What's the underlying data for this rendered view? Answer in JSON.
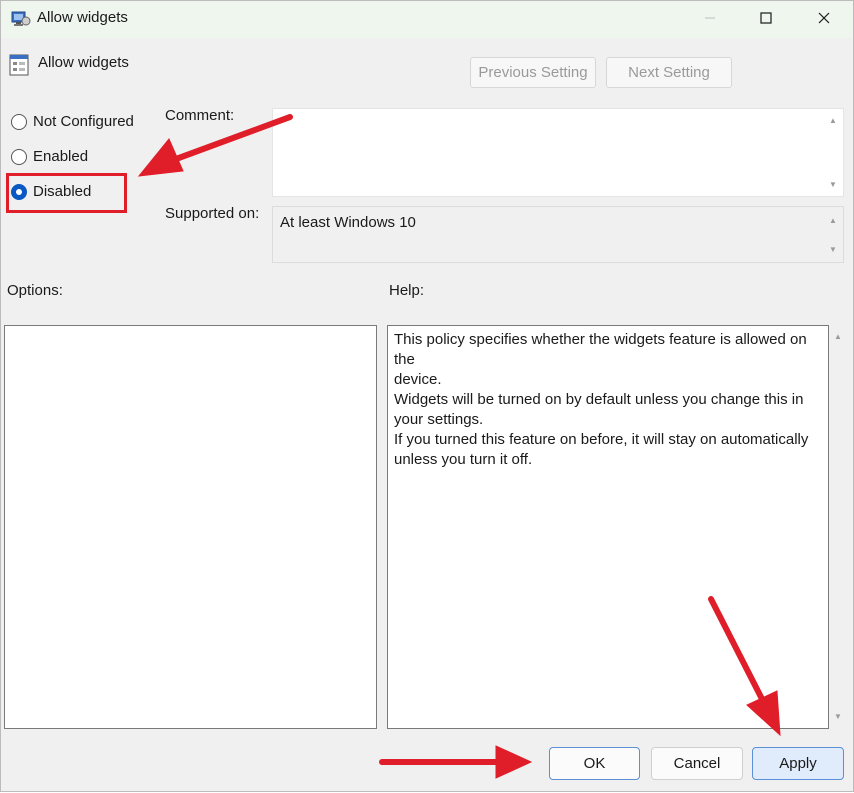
{
  "window": {
    "title": "Allow widgets",
    "setting_name": "Allow widgets"
  },
  "nav": {
    "previous_label": "Previous Setting",
    "next_label": "Next Setting"
  },
  "state_options": [
    {
      "label": "Not Configured",
      "selected": false
    },
    {
      "label": "Enabled",
      "selected": false
    },
    {
      "label": "Disabled",
      "selected": true
    }
  ],
  "labels": {
    "comment": "Comment:",
    "supported_on": "Supported on:",
    "options": "Options:",
    "help": "Help:"
  },
  "comment_value": "",
  "supported_on_value": "At least Windows 10",
  "help_lines": [
    "This policy specifies whether the widgets feature is allowed on the",
    "device.",
    "Widgets will be turned on by default unless you change this in",
    "your settings.",
    "If you turned this feature on before, it will stay on automatically",
    "unless you turn it off."
  ],
  "buttons": {
    "ok": "OK",
    "cancel": "Cancel",
    "apply": "Apply"
  },
  "colors": {
    "annotation_red": "#e01e2a",
    "radio_selected": "#0a58c2",
    "titlebar_bg": "#eef6ee"
  },
  "icons": {
    "title_icon": "group-policy-icon",
    "setting_icon": "policy-setting-icon",
    "minimize": "minimize-icon",
    "maximize": "maximize-icon",
    "close": "close-icon"
  }
}
